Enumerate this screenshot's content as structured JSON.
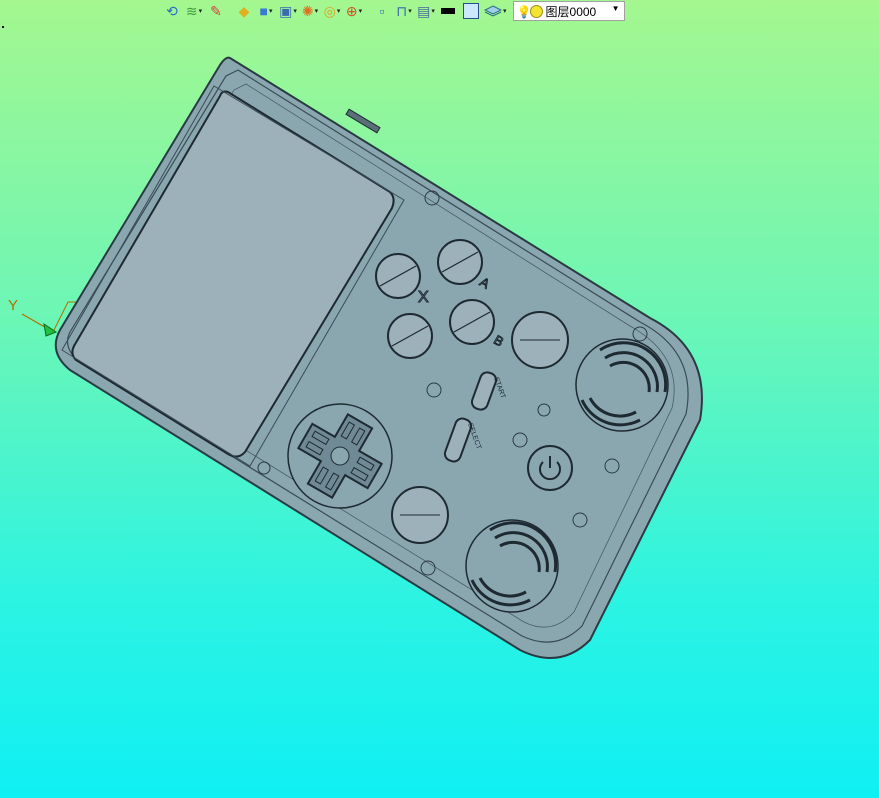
{
  "toolbar": {
    "buttons": [
      {
        "name": "undo-view-icon",
        "glyph": "⟲",
        "dropdown": false
      },
      {
        "name": "layer-tool-icon",
        "glyph": "≋",
        "dropdown": true
      },
      {
        "name": "pencil-icon",
        "glyph": "✎",
        "dropdown": false
      },
      {
        "name": "solid-shade-icon",
        "glyph": "◆",
        "dropdown": false
      },
      {
        "name": "cube-icon",
        "glyph": "■",
        "dropdown": true
      },
      {
        "name": "view-orient-icon",
        "glyph": "▣",
        "dropdown": true
      },
      {
        "name": "render-mode-icon",
        "glyph": "✺",
        "dropdown": true
      },
      {
        "name": "zoom-fit-icon",
        "glyph": "◎",
        "dropdown": true
      },
      {
        "name": "crosshair-icon",
        "glyph": "⊕",
        "dropdown": true
      },
      {
        "name": "window-select-icon",
        "glyph": "▫",
        "dropdown": false
      },
      {
        "name": "section-icon",
        "glyph": "⊓",
        "dropdown": true
      },
      {
        "name": "display-icon",
        "glyph": "▤",
        "dropdown": true
      }
    ],
    "line_color": "#000000",
    "fill_color": "#cce8ff",
    "layers_icon": "layers-icon",
    "layer_value": "图层0000"
  },
  "axis": {
    "label": "Y",
    "color": "#b07000"
  },
  "model": {
    "body_fill": "#8aa7b0",
    "edge_color": "#2a3a44",
    "screen_fill": "#9cb1b9",
    "button_labels": [
      "X",
      "A",
      "B"
    ],
    "start_select_labels": [
      "START",
      "SELECT"
    ]
  }
}
